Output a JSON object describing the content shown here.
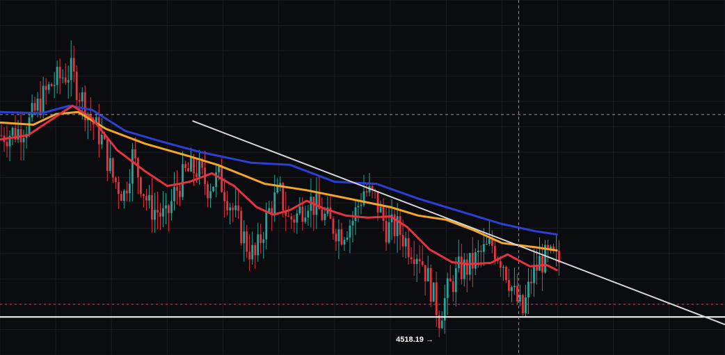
{
  "chart_data": {
    "type": "candlestick",
    "ylim": [
      4480,
      5320
    ],
    "x_count": 260,
    "grid": true,
    "colors": {
      "background": "#0b0c0f",
      "grid": "#1b1d23",
      "up": "#26a69a",
      "down": "#e8323f",
      "crosshair": "#9a9a9a",
      "price_line": "#d05050",
      "support": "#ffffff",
      "trendline": "#d6d6d6"
    },
    "annotation": {
      "text": "4518.19 →",
      "x": 152,
      "y": 4518.19
    },
    "price_level_dashed": 4600,
    "support_level": 4570,
    "crosshair": {
      "x": 186,
      "y": 5049
    },
    "trendline": {
      "x1": 69,
      "y1": 5034,
      "x2": 260,
      "y2": 4552
    },
    "ma_series": [
      {
        "color": "#2c3fd6",
        "points": [
          [
            0,
            5055
          ],
          [
            15,
            5052
          ],
          [
            25,
            5070
          ],
          [
            33,
            5060
          ],
          [
            45,
            5010
          ],
          [
            58,
            4985
          ],
          [
            72,
            4960
          ],
          [
            90,
            4935
          ],
          [
            104,
            4930
          ],
          [
            120,
            4890
          ],
          [
            135,
            4885
          ],
          [
            150,
            4850
          ],
          [
            165,
            4820
          ],
          [
            180,
            4790
          ],
          [
            192,
            4773
          ],
          [
            200,
            4765
          ]
        ]
      },
      {
        "color": "#f5a623",
        "points": [
          [
            0,
            5030
          ],
          [
            12,
            5025
          ],
          [
            20,
            5050
          ],
          [
            28,
            5055
          ],
          [
            38,
            5015
          ],
          [
            52,
            4980
          ],
          [
            68,
            4950
          ],
          [
            78,
            4930
          ],
          [
            95,
            4885
          ],
          [
            110,
            4870
          ],
          [
            125,
            4850
          ],
          [
            140,
            4830
          ],
          [
            150,
            4810
          ],
          [
            160,
            4800
          ],
          [
            170,
            4775
          ],
          [
            180,
            4745
          ],
          [
            192,
            4735
          ],
          [
            200,
            4727
          ]
        ]
      },
      {
        "color": "#e8323f",
        "points": [
          [
            0,
            4990
          ],
          [
            10,
            5000
          ],
          [
            18,
            5035
          ],
          [
            26,
            5070
          ],
          [
            33,
            5040
          ],
          [
            42,
            4965
          ],
          [
            52,
            4915
          ],
          [
            60,
            4880
          ],
          [
            68,
            4890
          ],
          [
            76,
            4910
          ],
          [
            84,
            4880
          ],
          [
            92,
            4830
          ],
          [
            98,
            4812
          ],
          [
            104,
            4823
          ],
          [
            110,
            4845
          ],
          [
            116,
            4827
          ],
          [
            124,
            4810
          ],
          [
            132,
            4805
          ],
          [
            140,
            4808
          ],
          [
            146,
            4783
          ],
          [
            154,
            4730
          ],
          [
            162,
            4700
          ],
          [
            168,
            4695
          ],
          [
            176,
            4698
          ],
          [
            182,
            4718
          ],
          [
            190,
            4690
          ],
          [
            196,
            4693
          ],
          [
            200,
            4680
          ]
        ]
      }
    ],
    "price_path": [
      [
        0,
        5000
      ],
      [
        6,
        5010
      ],
      [
        10,
        5030
      ],
      [
        14,
        5080
      ],
      [
        18,
        5120
      ],
      [
        22,
        5140
      ],
      [
        25,
        5150
      ],
      [
        28,
        5100
      ],
      [
        32,
        5040
      ],
      [
        36,
        4990
      ],
      [
        40,
        4900
      ],
      [
        44,
        4860
      ],
      [
        47,
        4950
      ],
      [
        50,
        4890
      ],
      [
        53,
        4830
      ],
      [
        56,
        4820
      ],
      [
        59,
        4800
      ],
      [
        62,
        4860
      ],
      [
        66,
        4910
      ],
      [
        70,
        4920
      ],
      [
        74,
        4880
      ],
      [
        78,
        4900
      ],
      [
        82,
        4840
      ],
      [
        85,
        4790
      ],
      [
        88,
        4740
      ],
      [
        91,
        4710
      ],
      [
        94,
        4780
      ],
      [
        97,
        4840
      ],
      [
        100,
        4860
      ],
      [
        103,
        4800
      ],
      [
        106,
        4810
      ],
      [
        110,
        4850
      ],
      [
        114,
        4820
      ],
      [
        118,
        4790
      ],
      [
        122,
        4770
      ],
      [
        126,
        4800
      ],
      [
        130,
        4870
      ],
      [
        134,
        4850
      ],
      [
        138,
        4780
      ],
      [
        142,
        4780
      ],
      [
        146,
        4740
      ],
      [
        150,
        4720
      ],
      [
        154,
        4640
      ],
      [
        157,
        4570
      ],
      [
        160,
        4630
      ],
      [
        164,
        4680
      ],
      [
        168,
        4690
      ],
      [
        172,
        4720
      ],
      [
        176,
        4740
      ],
      [
        180,
        4700
      ],
      [
        184,
        4620
      ],
      [
        187,
        4580
      ],
      [
        190,
        4660
      ],
      [
        193,
        4700
      ],
      [
        196,
        4710
      ],
      [
        200,
        4700
      ]
    ],
    "candle_end_index": 200
  }
}
